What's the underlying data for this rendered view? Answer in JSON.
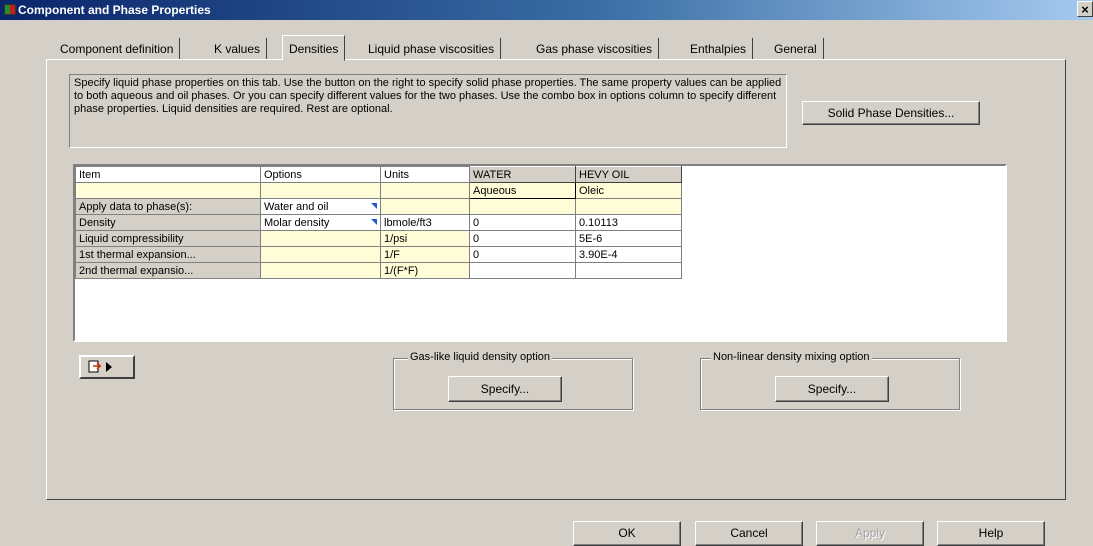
{
  "window": {
    "title": "Component and Phase Properties",
    "close_glyph": "×"
  },
  "tabs": [
    {
      "label": "Component definition",
      "active": false
    },
    {
      "label": "K values",
      "active": false
    },
    {
      "label": "Densities",
      "active": true
    },
    {
      "label": "Liquid phase viscosities",
      "active": false
    },
    {
      "label": "Gas phase viscosities",
      "active": false
    },
    {
      "label": "Enthalpies",
      "active": false
    },
    {
      "label": "General",
      "active": false
    }
  ],
  "description": "Specify liquid phase properties on this tab. Use the button on the right to specify solid phase properties. The same property values can be applied to both aqueous and oil phases. Or you can specify different values for the two phases. Use the combo box in options column to specify different phase properties. Liquid densities are required. Rest are optional.",
  "solid_phase_button": "Solid Phase Densities...",
  "grid": {
    "headers": [
      "Item",
      "Options",
      "Units",
      "WATER",
      "HEVY OIL"
    ],
    "phase_row": [
      "",
      "",
      "",
      "Aqueous",
      "Oleic"
    ],
    "rows": [
      {
        "item": "Apply data to phase(s):",
        "option": "Water and oil",
        "unit": "",
        "water": "",
        "oil": ""
      },
      {
        "item": "Density",
        "option": "Molar density",
        "unit": "lbmole/ft3",
        "water": "0",
        "oil": "0.10113"
      },
      {
        "item": "Liquid compressibility",
        "option": "",
        "unit": "1/psi",
        "water": "0",
        "oil": "5E-6"
      },
      {
        "item": "1st thermal expansion...",
        "option": "",
        "unit": "1/F",
        "water": "0",
        "oil": "3.90E-4"
      },
      {
        "item": "2nd thermal expansio...",
        "option": "",
        "unit": "1/(F*F)",
        "water": "",
        "oil": ""
      }
    ]
  },
  "gas_like_group": {
    "legend": "Gas-like liquid density option",
    "button": "Specify..."
  },
  "nonlinear_group": {
    "legend": "Non-linear density mixing option",
    "button": "Specify..."
  },
  "dialog_buttons": {
    "ok": "OK",
    "cancel": "Cancel",
    "apply": "Apply",
    "help": "Help"
  },
  "colors": {
    "title_start": "#0a246a",
    "title_end": "#a6caf0",
    "face": "#d4d0c8",
    "cell_yellow": "#fffdd8",
    "dropdown_marker": "#1f5fd0"
  }
}
